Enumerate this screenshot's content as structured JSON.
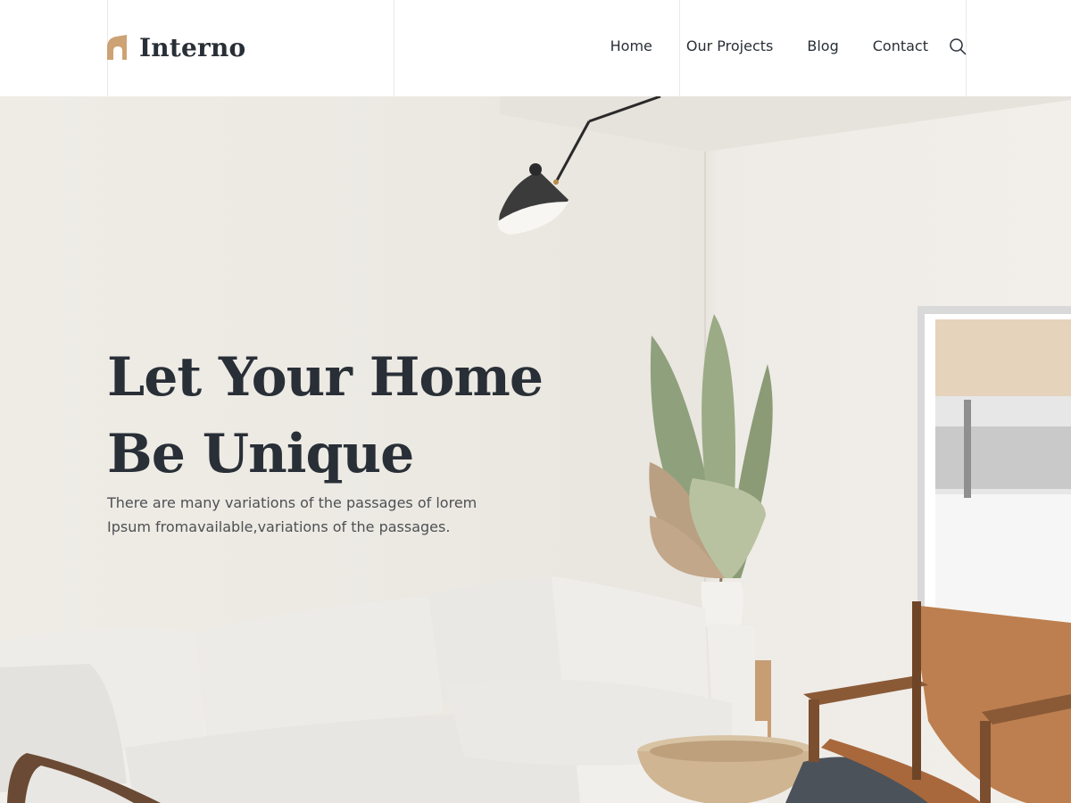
{
  "brand": {
    "name": "Interno",
    "accent_color": "#CDA274",
    "text_color": "#292F36"
  },
  "nav": {
    "items": [
      {
        "label": "Home"
      },
      {
        "label": "Our Projects"
      },
      {
        "label": "Blog"
      },
      {
        "label": "Contact"
      }
    ],
    "search_icon": "search-icon"
  },
  "hero": {
    "title": "Let Your Home\nBe Unique",
    "description": "There are many variations of the passages of lorem Ipsum fromavailable,variations of the passages.",
    "image": "living-room-interior"
  }
}
